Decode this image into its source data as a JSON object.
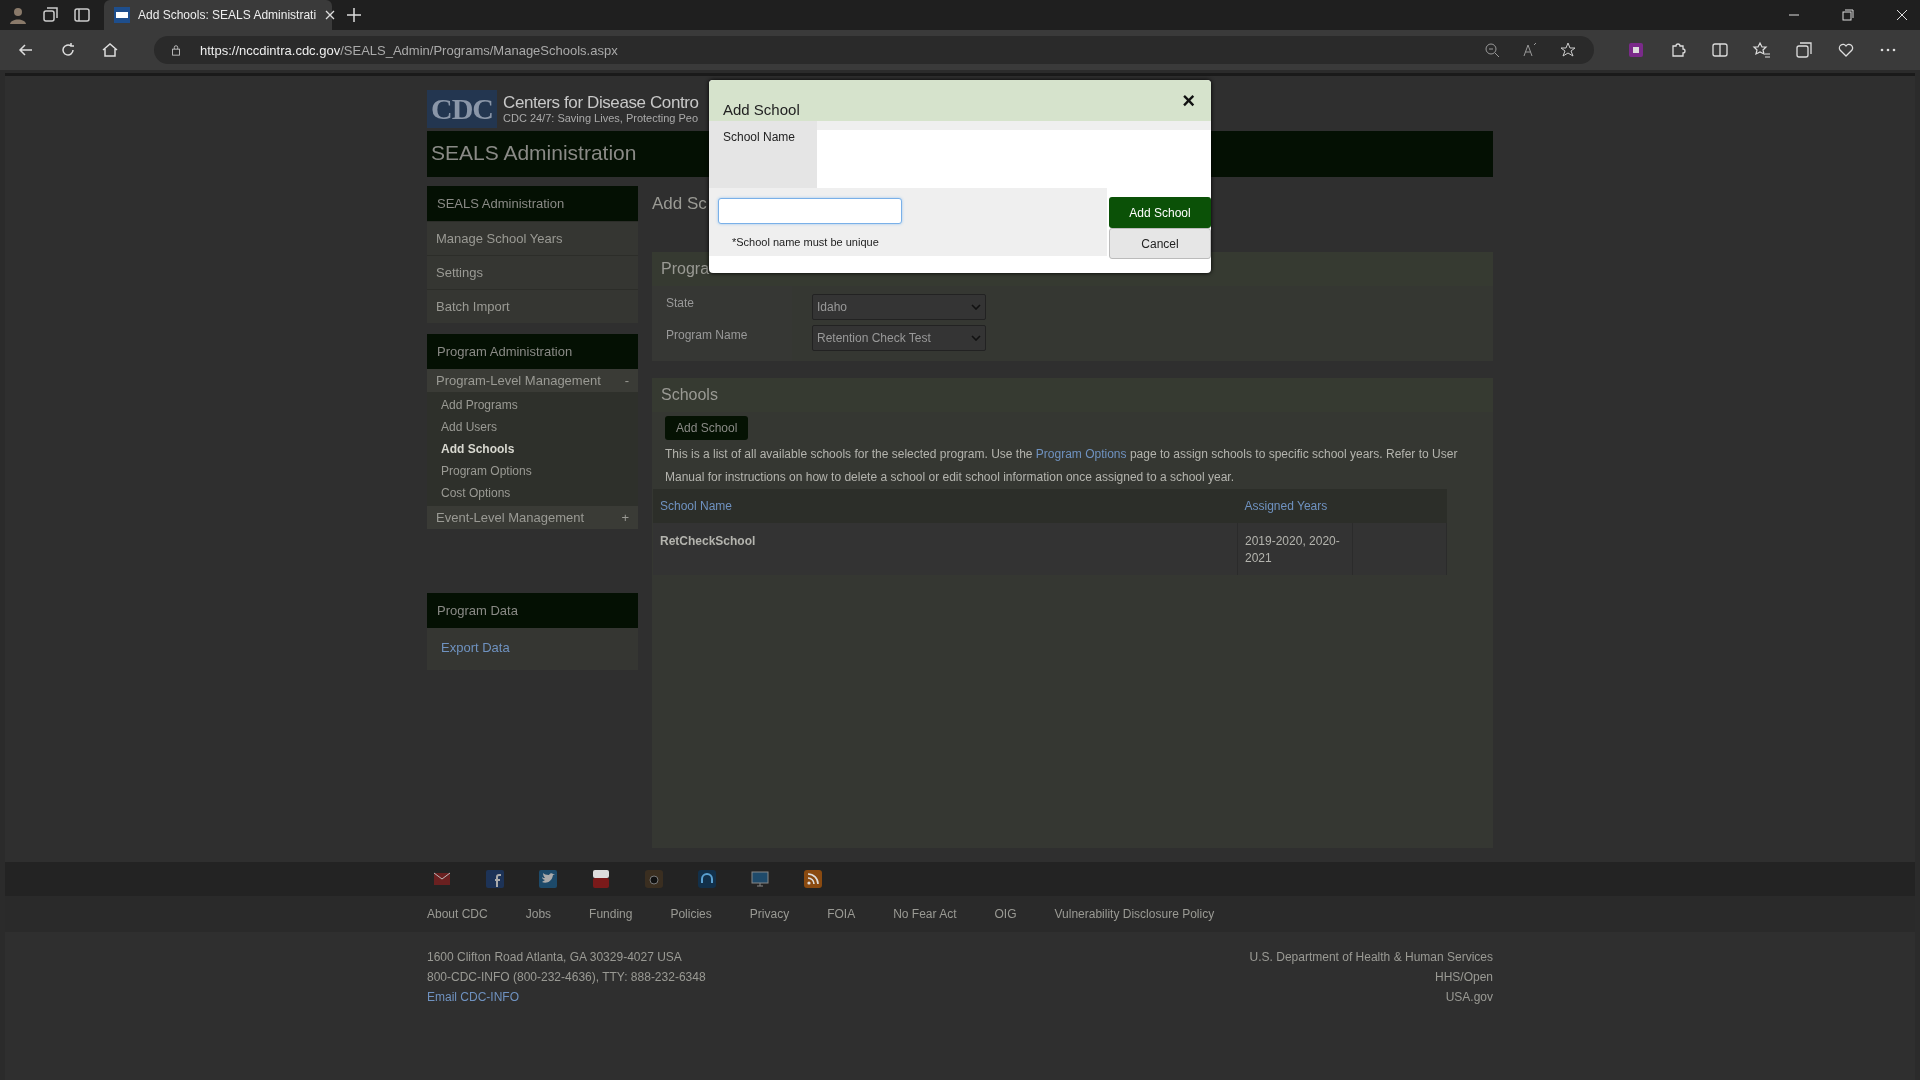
{
  "browser": {
    "tab_title": "Add Schools: SEALS Administrati",
    "url_host": "https://nccdintra.cdc.gov",
    "url_path": "/SEALS_Admin/Programs/ManageSchools.aspx"
  },
  "header": {
    "logo_text": "CDC",
    "org_name": "Centers for Disease Contro",
    "tagline": "CDC 24/7: Saving Lives, Protecting Peo",
    "banner": "SEALS Administration"
  },
  "sidebar": [
    {
      "title": "SEALS Administration",
      "items": [
        {
          "label": "Manage School Years"
        },
        {
          "label": "Settings"
        },
        {
          "label": "Batch Import"
        }
      ]
    },
    {
      "title": "Program Administration",
      "groups": [
        {
          "label": "Program-Level Management",
          "toggle": "-",
          "expanded": true,
          "children": [
            {
              "label": "Add Programs",
              "selected": false
            },
            {
              "label": "Add Users",
              "selected": false
            },
            {
              "label": "Add Schools",
              "selected": true
            },
            {
              "label": "Program Options",
              "selected": false
            },
            {
              "label": "Cost Options",
              "selected": false
            }
          ]
        },
        {
          "label": "Event-Level Management",
          "toggle": "+",
          "expanded": false
        }
      ]
    },
    {
      "title": "Program Data",
      "links": [
        {
          "label": "Export Data"
        }
      ]
    }
  ],
  "main": {
    "page_title": "Add Sc",
    "program_panel": {
      "title": "Progra",
      "fields": [
        {
          "label": "State",
          "value": "Idaho"
        },
        {
          "label": "Program Name",
          "value": "Retention Check Test"
        }
      ]
    },
    "schools": {
      "title": "Schools",
      "add_button": "Add School",
      "description_before": "This is a list of all available schools for the selected program. Use the",
      "description_link": "Program Options",
      "description_after": "page to assign schools to specific school years. Refer to User Manual for instructions on how to delete a school or edit school information once assigned to a school year.",
      "table": {
        "columns": [
          "School Name",
          "Assigned Years"
        ],
        "rows": [
          {
            "cells": [
              "RetCheckSchool",
              "2019-2020, 2020-2021"
            ]
          }
        ]
      }
    }
  },
  "footer": {
    "links": [
      "About CDC",
      "Jobs",
      "Funding",
      "Policies",
      "Privacy",
      "FOIA",
      "No Fear Act",
      "OIG",
      "Vulnerability Disclosure Policy"
    ],
    "address": [
      {
        "text": "1600 Clifton Road Atlanta, GA 30329-4027 USA",
        "kind": "text"
      },
      {
        "text": "800-CDC-INFO (800-232-4636), TTY: 888-232-6348",
        "kind": "text"
      },
      {
        "text": "Email CDC-INFO",
        "kind": "link"
      }
    ],
    "agencies": [
      "U.S. Department of Health & Human Services",
      "HHS/Open",
      "USA.gov"
    ]
  },
  "dialog": {
    "title": "Add School",
    "close": "×",
    "field_label": "School Name",
    "note": "*School name must be unique",
    "buttons": [
      {
        "label": "Add School",
        "kind": "primary"
      },
      {
        "label": "Cancel",
        "kind": "secondary"
      }
    ]
  }
}
